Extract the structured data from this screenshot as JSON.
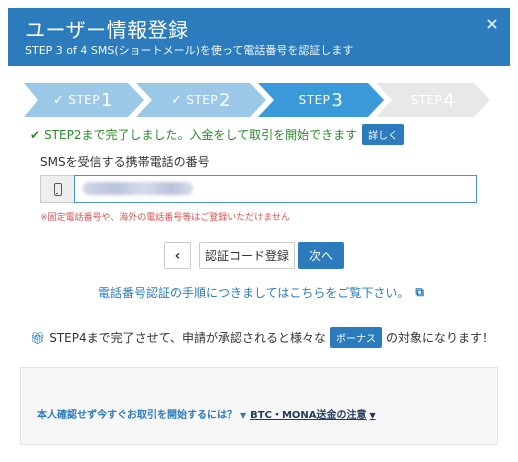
{
  "modal": {
    "title": "ユーザー情報登録",
    "subtitle": "STEP 3 of 4 SMS(ショートメール)を使って電話番号を認証します",
    "close_symbol": "×"
  },
  "steps": [
    {
      "prefix": "STEP",
      "num": "1",
      "state": "done",
      "color": "#9cc8e8"
    },
    {
      "prefix": "STEP",
      "num": "2",
      "state": "done",
      "color": "#9cc8e8"
    },
    {
      "prefix": "STEP",
      "num": "3",
      "state": "current",
      "color": "#3a9ad9"
    },
    {
      "prefix": "STEP",
      "num": "4",
      "state": "todo",
      "color": "#e8e8e8"
    }
  ],
  "notice": {
    "text": "STEP2まで完了しました。入金をして取引を開始できます",
    "detail_label": "詳しく"
  },
  "phone": {
    "label": "SMSを受信する携帯電話の番号",
    "warning": "※固定電話番号や、海外の電話番号等はご登録いただけません"
  },
  "buttons": {
    "back_symbol": "‹",
    "register_label": "認証コード登録",
    "next_label": "次へ"
  },
  "guide": {
    "link_text": "電話番号認証の手順につきましてはこちらをご覧下さい。"
  },
  "info": {
    "before": "STEP4まで完了させて、申請が承認されると様々な",
    "badge": "ボーナス",
    "after": "の対象になります！"
  },
  "footer": {
    "link1": "本人確認せず今すぐお取引を開始するには？",
    "link2": "BTC・MONA送金の注意"
  },
  "colors": {
    "primary": "#2b7bbd",
    "success": "#2d8a2d",
    "danger": "#d9534f"
  }
}
